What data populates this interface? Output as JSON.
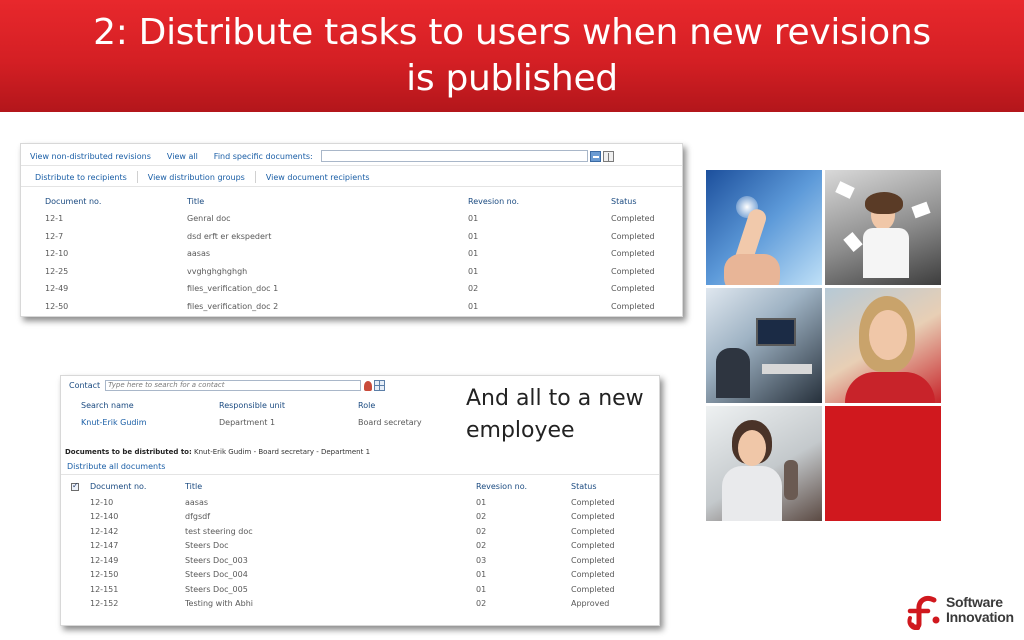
{
  "slide": {
    "title": "2: Distribute tasks to users when new revisions is published",
    "note": "And all to a new employee"
  },
  "panel1": {
    "toolbar1": {
      "view_non_distributed": "View non-distributed revisions",
      "view_all": "View all",
      "find_label": "Find specific documents:",
      "find_value": ""
    },
    "toolbar2": {
      "distribute": "Distribute to recipients",
      "view_groups": "View distribution groups",
      "view_recipients": "View document recipients"
    },
    "columns": [
      "Document no.",
      "Title",
      "Revesion no.",
      "Status"
    ],
    "rows": [
      [
        "12-1",
        "Genral doc",
        "01",
        "Completed"
      ],
      [
        "12-7",
        "dsd erft er ekspedert",
        "01",
        "Completed"
      ],
      [
        "12-10",
        "aasas",
        "01",
        "Completed"
      ],
      [
        "12-25",
        "vvghghghghgh",
        "01",
        "Completed"
      ],
      [
        "12-49",
        "files_verification_doc 1",
        "02",
        "Completed"
      ],
      [
        "12-50",
        "files_verification_doc 2",
        "01",
        "Completed"
      ]
    ]
  },
  "panel2": {
    "contact_label": "Contact",
    "contact_placeholder": "Type here to search for a contact",
    "search_columns": [
      "Search name",
      "Responsible unit",
      "Role"
    ],
    "search_row": [
      "Knut-Erik Gudim",
      "Department 1",
      "Board secretary"
    ],
    "dist_label": "Documents to be distributed to:",
    "dist_value": "Knut-Erik Gudim - Board secretary - Department 1",
    "distribute_all": "Distribute all documents",
    "columns": [
      "Document no.",
      "Title",
      "Revesion no.",
      "Status"
    ],
    "rows": [
      [
        "12-10",
        "aasas",
        "01",
        "Completed"
      ],
      [
        "12-140",
        "dfgsdf",
        "02",
        "Completed"
      ],
      [
        "12-142",
        "test steering doc",
        "02",
        "Completed"
      ],
      [
        "12-147",
        "Steers Doc",
        "02",
        "Completed"
      ],
      [
        "12-149",
        "Steers Doc_003",
        "03",
        "Completed"
      ],
      [
        "12-150",
        "Steers Doc_004",
        "01",
        "Completed"
      ],
      [
        "12-151",
        "Steers Doc_005",
        "01",
        "Completed"
      ],
      [
        "12-152",
        "Testing with Abhi",
        "02",
        "Approved"
      ]
    ]
  },
  "logo": {
    "line1": "Software",
    "line2": "Innovation"
  },
  "colors": {
    "banner_red": "#d41f24",
    "link_blue": "#1a5ea6",
    "logo_red": "#d0181e"
  }
}
